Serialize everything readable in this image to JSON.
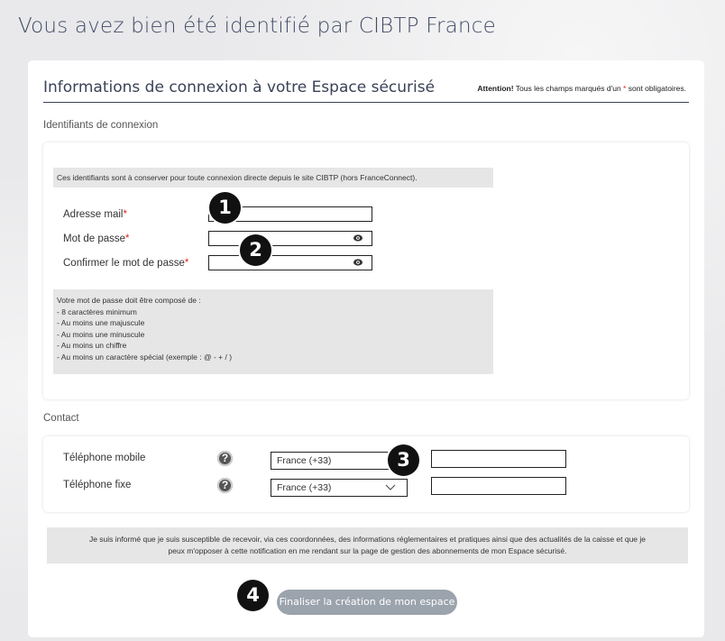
{
  "page_title": "Vous avez bien été identifié par CIBTP France",
  "section": {
    "title": "Informations de connexion à votre Espace sécurisé",
    "attention_strong": "Attention!",
    "attention_pre": "Tous les champs marqués d'un",
    "attention_star": "*",
    "attention_post": "sont obligatoires."
  },
  "credentials": {
    "heading": "Identifiants de connexion",
    "note": "Ces identifiants sont à conserver pour toute connexion directe depuis le site CIBTP (hors FranceConnect).",
    "email_label": "Adresse mail",
    "password_label": "Mot de passe",
    "confirm_label": "Confirmer le mot de passe",
    "required_mark": "*",
    "rules": [
      "Votre mot de passe doit être composé de :",
      "- 8 caractères minimum",
      "- Au moins une majuscule",
      "- Au moins une minuscule",
      "- Au moins un chiffre",
      "- Au moins un caractère spécial (exemple : @ - + / )"
    ]
  },
  "contact": {
    "heading": "Contact",
    "mobile_label": "Téléphone mobile",
    "fixe_label": "Téléphone fixe",
    "country_value": "France (+33)",
    "help_glyph": "?"
  },
  "notice": {
    "line1": "Je suis informé que je suis susceptible de recevoir, via ces coordonnées, des informations réglementaires et pratiques ainsi que des actualités de la caisse et que je",
    "line2": "peux m'opposer à cette notification en me rendant sur la page de gestion des abonnements de mon Espace sécurisé."
  },
  "finish_label": "Finaliser la création de mon espace",
  "badges": [
    "1",
    "2",
    "3",
    "4"
  ],
  "colors": {
    "required": "#e0261b",
    "title": "#414a66",
    "button": "#9ba3ad"
  }
}
